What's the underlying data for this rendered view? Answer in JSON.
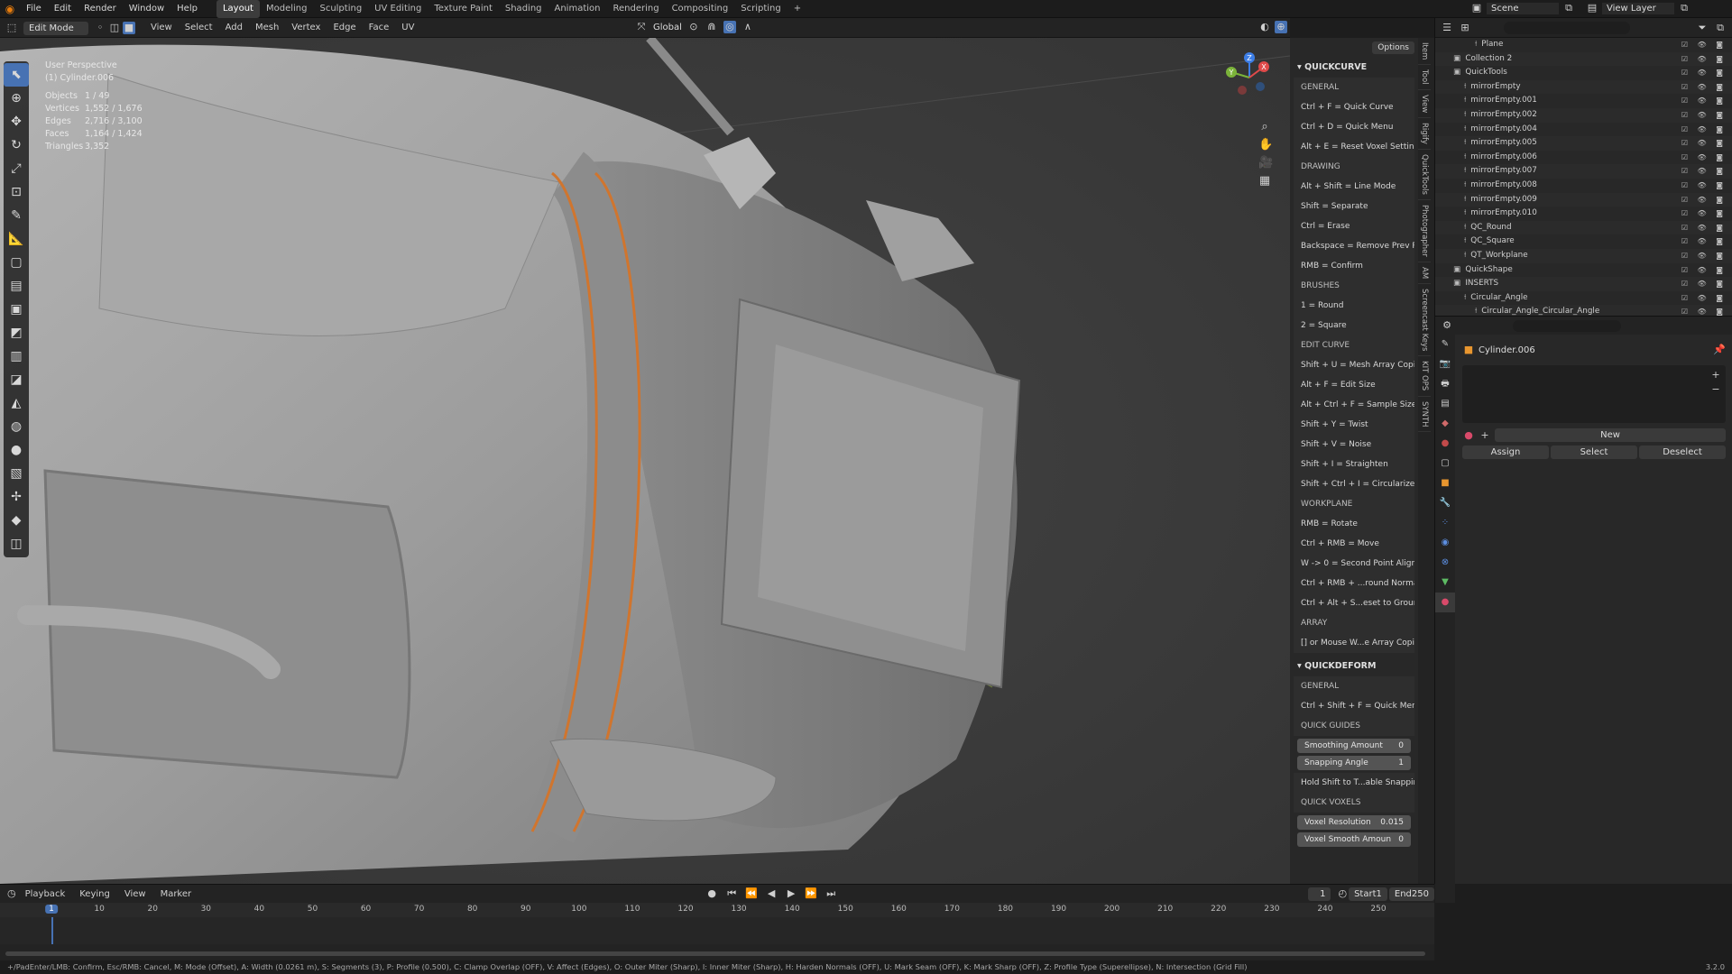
{
  "topbar": {
    "menus": [
      "File",
      "Edit",
      "Render",
      "Window",
      "Help"
    ],
    "workspaces": [
      "Layout",
      "Modeling",
      "Sculpting",
      "UV Editing",
      "Texture Paint",
      "Shading",
      "Animation",
      "Rendering",
      "Compositing",
      "Scripting"
    ],
    "active_workspace": "Layout",
    "add": "+",
    "scene": "Scene",
    "view_layer": "View Layer"
  },
  "viewport_header": {
    "mode": "Edit Mode",
    "menus": [
      "View",
      "Select",
      "Add",
      "Mesh",
      "Vertex",
      "Edge",
      "Face",
      "UV"
    ],
    "orientation": "Global",
    "options": "Options",
    "axes": [
      "X",
      "Y",
      "Z"
    ]
  },
  "overlay": {
    "perspective": "User Perspective",
    "object": "(1) Cylinder.006",
    "stats": [
      {
        "label": "Objects",
        "value": "1 / 49"
      },
      {
        "label": "Vertices",
        "value": "1,552 / 1,676"
      },
      {
        "label": "Edges",
        "value": "2,716 / 3,100"
      },
      {
        "label": "Faces",
        "value": "1,164 / 1,424"
      },
      {
        "label": "Triangles",
        "value": "3,352"
      }
    ]
  },
  "gizmo": {
    "x": "X",
    "y": "Y",
    "z": "Z"
  },
  "npanel": {
    "quickcurve_title": "QUICKCURVE",
    "qc_groups": [
      {
        "title": "GENERAL",
        "items": [
          "Ctrl + F = Quick Curve",
          "Ctrl + D = Quick Menu",
          "Alt + E = Reset Voxel Settin..."
        ]
      },
      {
        "title": "DRAWING",
        "items": [
          "Alt + Shift = Line Mode",
          "Shift = Separate",
          "Ctrl = Erase",
          "Backspace = Remove Prev P",
          "RMB = Confirm"
        ]
      },
      {
        "title": "BRUSHES",
        "items": [
          "1 = Round",
          "2 = Square"
        ]
      },
      {
        "title": "EDIT CURVE",
        "items": [
          "Shift + U = Mesh Array Copi...",
          "Alt + F = Edit Size",
          "Alt + Ctrl + F = Sample Size",
          "Shift + Y = Twist",
          "Shift + V = Noise",
          "Shift + I = Straighten",
          "Shift + Ctrl + I = Circularize"
        ]
      },
      {
        "title": "WORKPLANE",
        "items": [
          "RMB = Rotate",
          "Ctrl + RMB = Move",
          "W -> 0 = Second Point Align",
          "Ctrl + RMB + ...round Normal",
          "Ctrl + Alt + S...eset to Ground"
        ]
      },
      {
        "title": "ARRAY",
        "items": [
          "[] or Mouse W...e Array Copies"
        ]
      }
    ],
    "quickdeform_title": "QUICKDEFORM",
    "qd_general_title": "GENERAL",
    "qd_general_item": "Ctrl + Shift + F = Quick Menu",
    "qd_guides_title": "QUICK GUIDES",
    "smoothing_label": "Smoothing Amount",
    "smoothing_value": "0",
    "snapping_label": "Snapping Angle",
    "snapping_value": "1",
    "hold_shift": "Hold Shift to T...able Snapping",
    "voxels_title": "QUICK VOXELS",
    "voxel_res_label": "Voxel Resolution",
    "voxel_res_value": "0.015",
    "voxel_smooth_label": "Voxel Smooth Amoun",
    "voxel_smooth_value": "0"
  },
  "side_tabs": [
    "Item",
    "Tool",
    "View",
    "Rigify",
    "QuickTools",
    "Photographer",
    "AM",
    "Screencast Keys",
    "KIT OPS",
    "SYNTH"
  ],
  "outliner": {
    "rows": [
      {
        "name": "Plane",
        "indent": 3
      },
      {
        "name": "Collection 2",
        "indent": 1
      },
      {
        "name": "QuickTools",
        "indent": 1
      },
      {
        "name": "mirrorEmpty",
        "indent": 2
      },
      {
        "name": "mirrorEmpty.001",
        "indent": 2
      },
      {
        "name": "mirrorEmpty.002",
        "indent": 2
      },
      {
        "name": "mirrorEmpty.004",
        "indent": 2
      },
      {
        "name": "mirrorEmpty.005",
        "indent": 2
      },
      {
        "name": "mirrorEmpty.006",
        "indent": 2
      },
      {
        "name": "mirrorEmpty.007",
        "indent": 2
      },
      {
        "name": "mirrorEmpty.008",
        "indent": 2
      },
      {
        "name": "mirrorEmpty.009",
        "indent": 2
      },
      {
        "name": "mirrorEmpty.010",
        "indent": 2
      },
      {
        "name": "QC_Round",
        "indent": 2
      },
      {
        "name": "QC_Square",
        "indent": 2
      },
      {
        "name": "QT_Workplane",
        "indent": 2
      },
      {
        "name": "QuickShape",
        "indent": 1
      },
      {
        "name": "INSERTS",
        "indent": 1
      },
      {
        "name": "Circular_Angle",
        "indent": 2
      },
      {
        "name": "Circular_Angle_Circular_Angle",
        "indent": 3
      }
    ]
  },
  "properties": {
    "object": "Cylinder.006",
    "new": "New",
    "assign": "Assign",
    "select": "Select",
    "deselect": "Deselect"
  },
  "timeline": {
    "menus": [
      "Playback",
      "Keying",
      "View",
      "Marker"
    ],
    "current": "1",
    "start_label": "Start",
    "start": "1",
    "end_label": "End",
    "end": "250",
    "ticks": [
      "1",
      "10",
      "20",
      "30",
      "40",
      "50",
      "60",
      "70",
      "80",
      "90",
      "100",
      "110",
      "120",
      "130",
      "140",
      "150",
      "160",
      "170",
      "180",
      "190",
      "200",
      "210",
      "220",
      "230",
      "240",
      "250"
    ]
  },
  "status": {
    "text": "+/PadEnter/LMB: Confirm, Esc/RMB: Cancel, M: Mode (Offset), A: Width (0.0261 m), S: Segments (3), P: Profile (0.500), C: Clamp Overlap (OFF), V: Affect (Edges), O: Outer Miter (Sharp), I: Inner Miter (Sharp), H: Harden Normals (OFF), U: Mark Seam (OFF), K: Mark Sharp (OFF), Z: Profile Type (Superellipse), N: Intersection (Grid Fill)",
    "version": "3.2.0"
  }
}
